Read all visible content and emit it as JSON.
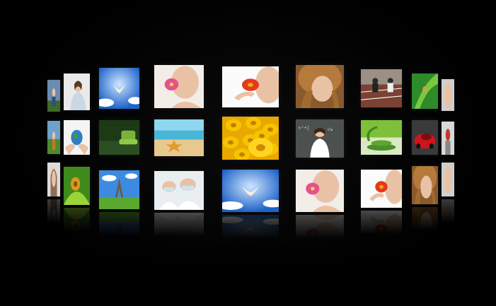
{
  "background_color": "#000000",
  "wall": {
    "rows": [
      {
        "row": "top",
        "tiles": [
          {
            "subject": "person-at-desk",
            "icon": "person-icon"
          },
          {
            "subject": "woman-with-documents",
            "icon": "person-icon"
          },
          {
            "subject": "dove-in-blue-sky",
            "icon": "bird-icon"
          },
          {
            "subject": "woman-with-pink-flower",
            "icon": "flower-icon"
          },
          {
            "subject": "woman-blowing-red-flower",
            "icon": "flower-icon"
          },
          {
            "subject": "woman-with-curly-hair",
            "icon": "person-icon"
          },
          {
            "subject": "runners-at-start-line",
            "icon": "runner-icon"
          },
          {
            "subject": "green-leaf-closeup",
            "icon": "leaf-icon"
          },
          {
            "subject": "portrait-edge",
            "icon": "person-icon"
          }
        ]
      },
      {
        "row": "middle",
        "tiles": [
          {
            "subject": "person-on-grass",
            "icon": "person-icon"
          },
          {
            "subject": "hands-holding-globe",
            "icon": "globe-icon"
          },
          {
            "subject": "green-armchair",
            "icon": "chair-icon"
          },
          {
            "subject": "starfish-on-beach",
            "icon": "starfish-icon"
          },
          {
            "subject": "yellow-flowers",
            "icon": "flower-icon"
          },
          {
            "subject": "woman-at-chalkboard",
            "icon": "person-icon"
          },
          {
            "subject": "green-spa-stones",
            "icon": "leaf-icon"
          },
          {
            "subject": "red-car",
            "icon": "car-icon"
          },
          {
            "subject": "people-edge",
            "icon": "person-icon"
          }
        ]
      },
      {
        "row": "bottom",
        "tiles": [
          {
            "subject": "woman-portrait",
            "icon": "person-icon"
          },
          {
            "subject": "yellow-flower-on-green",
            "icon": "flower-icon"
          },
          {
            "subject": "eiffel-tower",
            "icon": "tower-icon"
          },
          {
            "subject": "doctors-in-masks",
            "icon": "person-icon"
          },
          {
            "subject": "dove-in-blue-sky",
            "icon": "bird-icon"
          },
          {
            "subject": "woman-with-pink-flower",
            "icon": "flower-icon"
          },
          {
            "subject": "woman-blowing-red-flower",
            "icon": "flower-icon"
          },
          {
            "subject": "woman-with-curly-hair",
            "icon": "person-icon"
          },
          {
            "subject": "portrait-edge",
            "icon": "person-icon"
          }
        ]
      }
    ]
  },
  "colors": {
    "sky_blue": "#1f63c9",
    "grass_green": "#5aa82e",
    "sunflower_yellow": "#f5c400",
    "skin": "#e9c2a6",
    "hair_brown": "#8a5a2e",
    "flower_pink": "#e4528c",
    "flower_red": "#e23a1a",
    "beach_sand": "#e7c98e",
    "sea_cyan": "#49b6d6",
    "chalkboard": "#4d514e",
    "car_red": "#d0141e",
    "white": "#ffffff"
  }
}
